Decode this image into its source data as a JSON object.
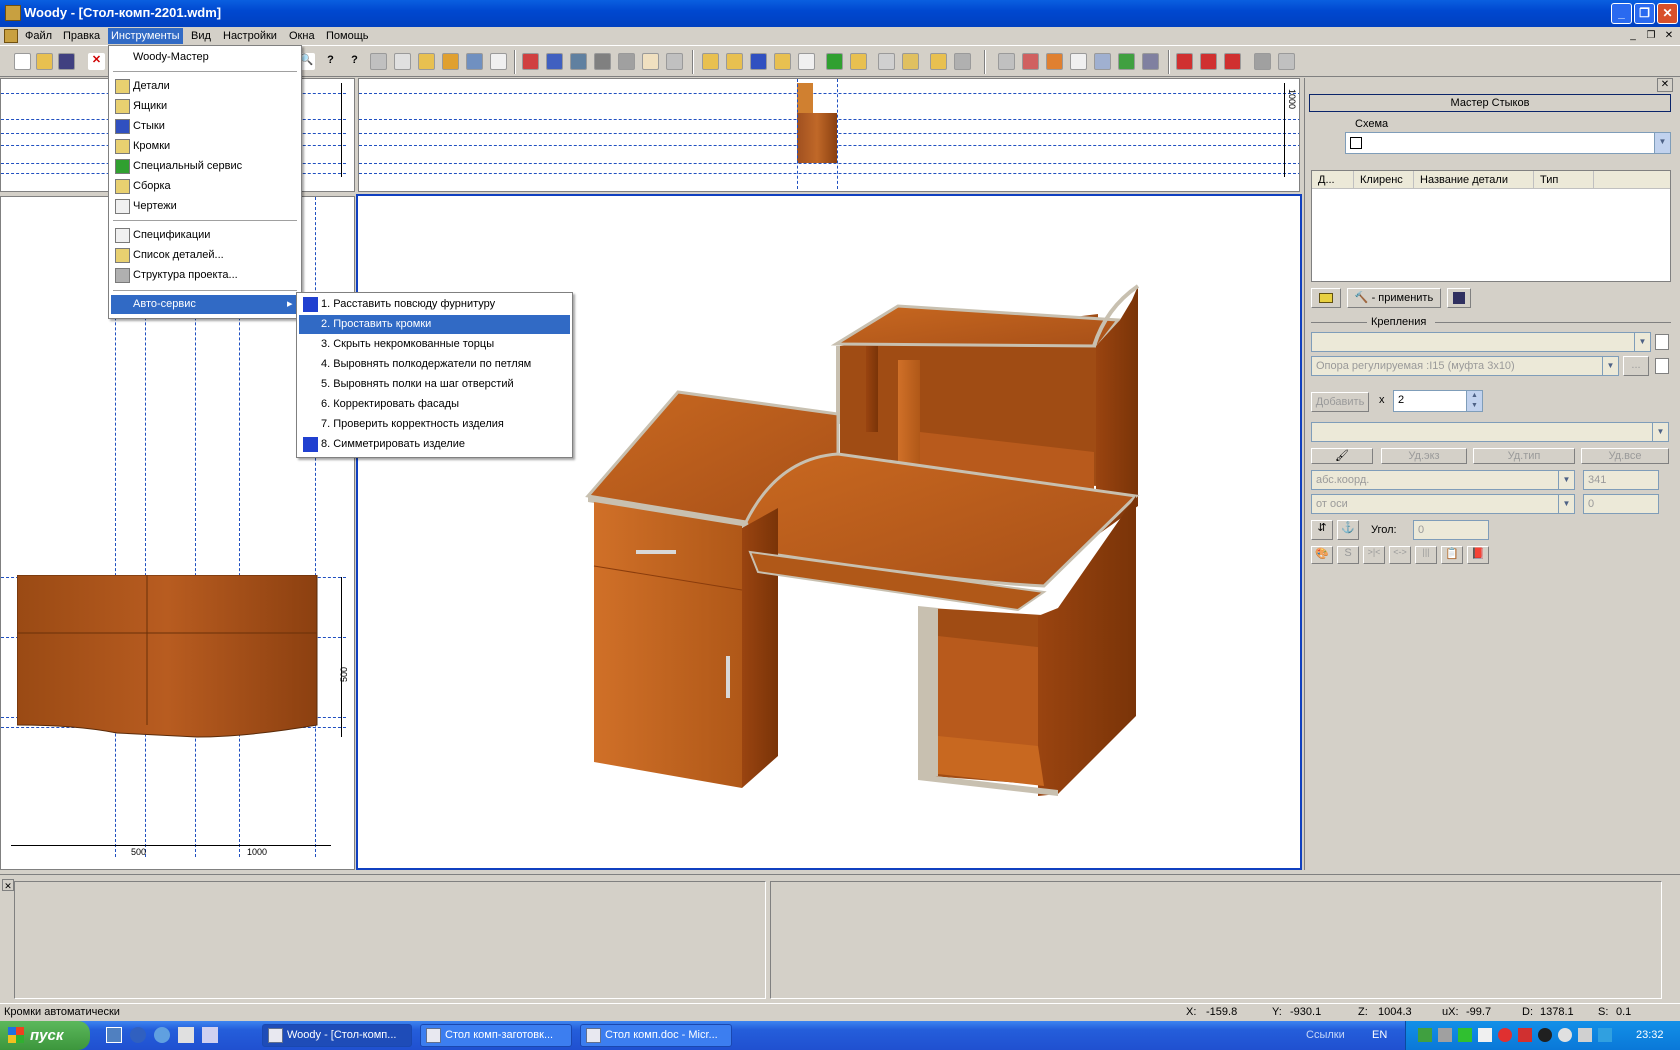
{
  "window": {
    "title": "Woody - [Стол-комп-2201.wdm]"
  },
  "menubar": {
    "items": [
      "Файл",
      "Правка",
      "Инструменты",
      "Вид",
      "Настройки",
      "Окна",
      "Помощь"
    ]
  },
  "tools_menu": {
    "items": [
      "Woody-Мастер",
      "Детали",
      "Ящики",
      "Стыки",
      "Кромки",
      "Специальный сервис",
      "Сборка",
      "Чертежи",
      "Спецификации",
      "Список деталей...",
      "Структура проекта...",
      "Авто-сервис"
    ]
  },
  "auto_menu": {
    "items": [
      "1. Расставить повсюду фурнитуру",
      "2. Проставить кромки",
      "3. Скрыть некромкованные  торцы",
      "4. Выровнять полкодержатели по петлям",
      "5. Выровнять полки на шаг отверстий",
      "6. Корректировать фасады",
      "7. Проверить корректность изделия",
      "8. Симметрировать изделие"
    ]
  },
  "views": {
    "ruler_side": "1000",
    "ruler_mid": "500",
    "ruler_x1": "500",
    "ruler_x2": "1000"
  },
  "panel": {
    "title": "Мастер Стыков",
    "schema_label": "Схема",
    "columns": [
      "Д...",
      "Клиренс",
      "Название детали",
      "Тип"
    ],
    "apply": "- применить",
    "fastenings_label": "Крепления",
    "support_value": "Опора регулируемая :I15 (муфта 3x10)",
    "add": "Добавить",
    "times": "x",
    "qty": "2",
    "del_exz": "Уд.экз",
    "del_type": "Уд.тип",
    "del_all": "Уд.все",
    "coord_mode": "абс.коорд.",
    "coord_value": "341",
    "from_axis": "от оси",
    "axis_value": "0",
    "angle_label": "Угол:",
    "angle_value": "0",
    "small_s": "S",
    "small_a": ">|<",
    "small_b": "<->",
    "small_c": "|||"
  },
  "status": {
    "message": "Кромки автоматически",
    "x_label": "X:",
    "x": "-159.8",
    "y_label": "Y:",
    "y": "-930.1",
    "z_label": "Z:",
    "z": "1004.3",
    "ux_label": "uX:",
    "ux": "-99.7",
    "d_label": "D:",
    "d": "1378.1",
    "s_label": "S:",
    "s": "0.1"
  },
  "taskbar": {
    "start": "пуск",
    "tasks": [
      "Woody - [Стол-комп...",
      "Стол комп-заготовк...",
      "Стол комп.doc - Micr..."
    ],
    "links": "Ссылки",
    "lang": "EN",
    "clock": "23:32"
  },
  "colors": {
    "title": "#0048d0",
    "selection": "#316ac5",
    "wood": "#c0601c",
    "wood_dark": "#8a3c0c",
    "edge": "#c8c0b0"
  }
}
